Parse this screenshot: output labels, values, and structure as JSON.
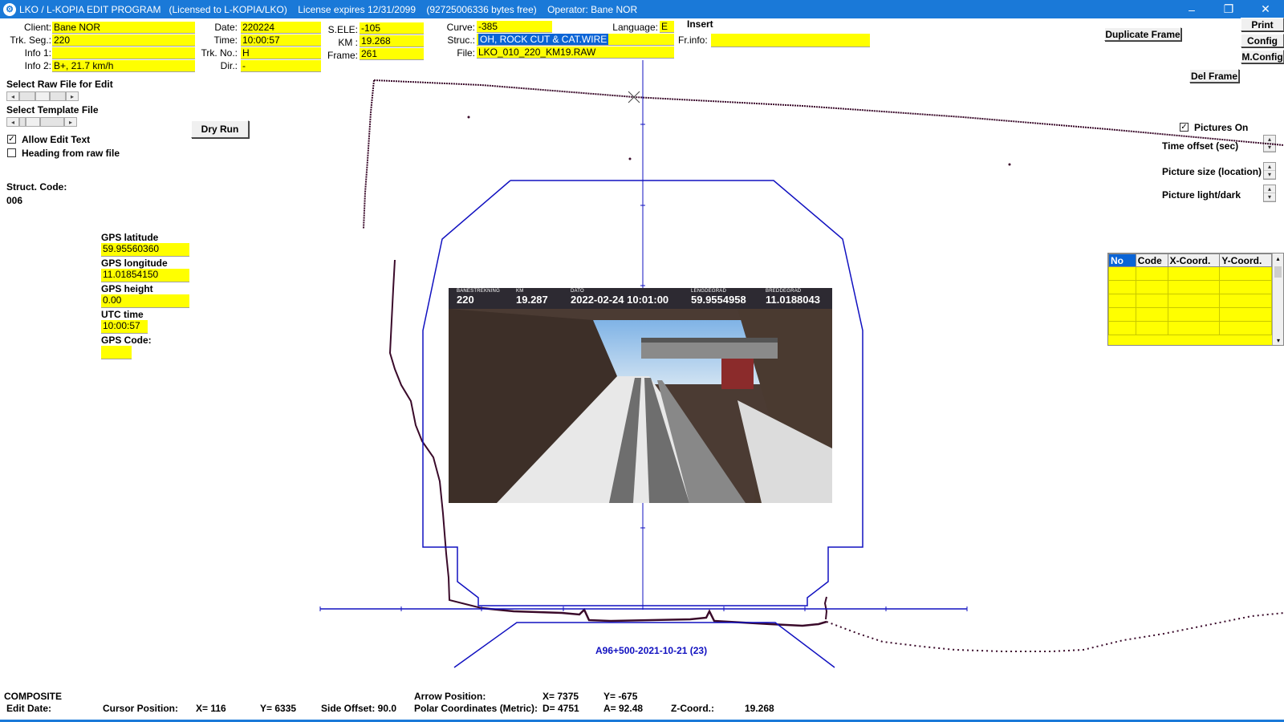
{
  "window": {
    "title": "LKO / L-KOPIA EDIT PROGRAM   (Licensed to L-KOPIA/LKO)    License expires 12/31/2099    (92725006336 bytes free)    Operator: Bane NOR",
    "icon": "gear-icon",
    "buttons": {
      "minimize": "–",
      "restore": "❐",
      "close": "✕"
    }
  },
  "header": {
    "client_label": "Client:",
    "client": "Bane NOR",
    "trkseg_label": "Trk. Seg.:",
    "trkseg": "220",
    "info1_label": "Info 1:",
    "info1": "",
    "info2_label": "Info 2:",
    "info2": "B+, 21.7 km/h",
    "date_label": "Date:",
    "date": "220224",
    "time_label": "Time:",
    "time": "10:00:57",
    "trkno_label": "Trk. No.:",
    "trkno": "H",
    "dir_label": "Dir.:",
    "dir": "-",
    "sele_label": "S.ELE:",
    "sele": "-105",
    "km_label": "KM :",
    "km": "19.268",
    "frame_label": "Frame:",
    "frame": "261",
    "curve_label": "Curve:",
    "curve": "-385",
    "language_label": "Language:",
    "language": "E",
    "struc_label": "Struc.:",
    "struc": "OH, ROCK CUT & CAT.WIRE",
    "file_label": "File:",
    "file": "LKO_010_220_KM19.RAW",
    "insert_label": "Insert",
    "frinfo_label": "Fr.info:",
    "frinfo": ""
  },
  "buttons": {
    "duplicate_frame": "Duplicate Frame",
    "print": "Print",
    "config": "Config",
    "mconfig": "M.Config",
    "del_frame": "Del Frame",
    "dry_run": "Dry Run"
  },
  "left": {
    "select_raw": "Select Raw File for Edit",
    "select_template": "Select Template File",
    "allow_edit_text": "Allow Edit Text",
    "allow_edit_checked": "✓",
    "heading_from_raw": "Heading from raw file",
    "struct_code_label": "Struct. Code:",
    "struct_code": "006"
  },
  "gps": {
    "lat_label": "GPS latitude",
    "lat": "59.95560360",
    "lon_label": "GPS longitude",
    "lon": "11.01854150",
    "height_label": "GPS height",
    "height": "0.00",
    "utc_label": "UTC time",
    "utc": "10:00:57",
    "code_label": "GPS Code:",
    "code": ""
  },
  "right": {
    "pictures_on": "Pictures On",
    "pictures_checked": "✓",
    "time_offset": "Time offset (sec)",
    "picture_size": "Picture size (location)",
    "picture_light": "Picture light/dark"
  },
  "grid": {
    "headers": [
      "No",
      "Code",
      "X-Coord.",
      "Y-Coord."
    ],
    "rows": 6
  },
  "photo": {
    "overlay": [
      {
        "k": "BANESTREKNING",
        "v": "220"
      },
      {
        "k": "KM",
        "v": "19.287"
      },
      {
        "k": "DATO",
        "v": "2022-02-24 10:01:00"
      },
      {
        "k": "LENGDEGRAD",
        "v": "59.9554958"
      },
      {
        "k": "BREDDEGRAD",
        "v": "11.0188043"
      }
    ]
  },
  "profile_label": "A96+500-2021-10-21  (23)",
  "status": {
    "composite": "COMPOSITE",
    "edit_date": "Edit Date:",
    "cursor_label": "Cursor Position:",
    "cursor_x": "X=  116",
    "cursor_y": "Y=  6335",
    "side_offset": "Side Offset:  90.0",
    "arrow_label": "Arrow Position:",
    "polar_label": "Polar Coordinates (Metric):",
    "arrow_x": "X= 7375",
    "arrow_y": "Y=  -675",
    "polar_d": "D= 4751",
    "polar_a": "A= 92.48",
    "zcoord_label": "Z-Coord.:",
    "zcoord": "19.268"
  },
  "colors": {
    "titlebar": "#1a79d8",
    "field": "#ffff00",
    "gauge": "#1010c0",
    "scan": "#3a0a2a"
  }
}
